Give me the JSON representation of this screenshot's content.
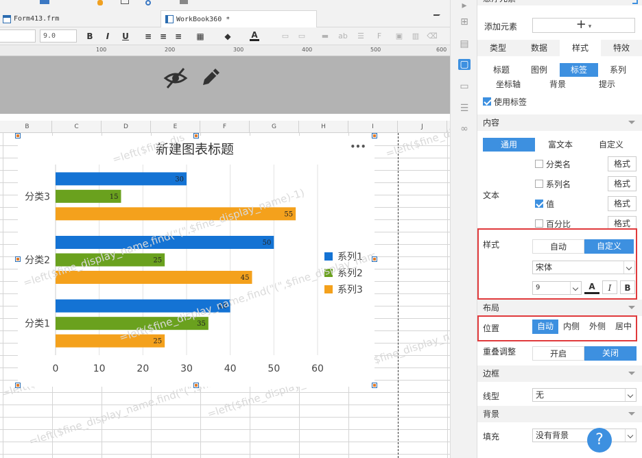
{
  "tabs": [
    {
      "label": "Form413.frm"
    },
    {
      "label": "WorkBook360 *"
    }
  ],
  "font_toolbar": {
    "font_size": "9.0",
    "bold": "B",
    "italic": "I",
    "underline": "U",
    "font_color": "A"
  },
  "ruler_ticks": [
    "100",
    "200",
    "300",
    "400",
    "500",
    "600",
    "700"
  ],
  "columns": [
    "B",
    "C",
    "D",
    "E",
    "F",
    "G",
    "H",
    "I",
    "J"
  ],
  "watermark": "=left($fine_display_name,find(\"(\",$fine_display_name)-1)",
  "watermark_short": "=left($fine_dis",
  "chart_menu": "•••",
  "chart_data": {
    "type": "bar",
    "orientation": "horizontal",
    "title": "新建图表标题",
    "categories": [
      "分类3",
      "分类2",
      "分类1"
    ],
    "series": [
      {
        "name": "系列1",
        "color": "#1473d4",
        "values": [
          30,
          50,
          40
        ]
      },
      {
        "name": "系列2",
        "color": "#6aa11e",
        "values": [
          15,
          25,
          35
        ]
      },
      {
        "name": "系列3",
        "color": "#f4a11c",
        "values": [
          55,
          45,
          25
        ]
      }
    ],
    "xlim": [
      0,
      60
    ],
    "xticks": [
      "0",
      "10",
      "20",
      "30",
      "40",
      "50",
      "60"
    ],
    "legend": "right",
    "grid": true
  },
  "panel": {
    "header": "悬浮元素",
    "add_label": "添加元素",
    "add_button": "+",
    "main_tabs": [
      {
        "label": "类型"
      },
      {
        "label": "数据"
      },
      {
        "label": "样式"
      },
      {
        "label": "特效"
      }
    ],
    "sub_tabs_1": [
      {
        "label": "标题"
      },
      {
        "label": "图例"
      },
      {
        "label": "标签"
      },
      {
        "label": "系列"
      }
    ],
    "sub_tabs_2": [
      {
        "label": "坐标轴"
      },
      {
        "label": "背景"
      },
      {
        "label": "提示"
      }
    ],
    "use_label": "使用标签",
    "content_section": "内容",
    "content_tabs": [
      {
        "label": "通用"
      },
      {
        "label": "富文本"
      },
      {
        "label": "自定义"
      }
    ],
    "text_label": "文本",
    "text_items": [
      {
        "label": "分类名",
        "checked": false,
        "button": "格式"
      },
      {
        "label": "系列名",
        "checked": false,
        "button": "格式"
      },
      {
        "label": "值",
        "checked": true,
        "button": "格式"
      },
      {
        "label": "百分比",
        "checked": false,
        "button": "格式"
      }
    ],
    "style_label": "样式",
    "style_options": [
      {
        "label": "自动"
      },
      {
        "label": "自定义"
      }
    ],
    "font_family": "宋体",
    "font_size": "9",
    "font_color_btn": "A",
    "italic_btn": "I",
    "bold_btn": "B",
    "layout_section": "布局",
    "position_label": "位置",
    "position_options": [
      {
        "label": "自动"
      },
      {
        "label": "内侧"
      },
      {
        "label": "外侧"
      },
      {
        "label": "居中"
      }
    ],
    "overlap_label": "重叠调整",
    "overlap_options": [
      {
        "label": "开启"
      },
      {
        "label": "关闭"
      }
    ],
    "border_section": "边框",
    "line_type_label": "线型",
    "line_type_value": "无",
    "background_section": "背景",
    "fill_label": "填充",
    "fill_value": "没有背景",
    "help_button": "?"
  },
  "colors": {
    "accent": "#3d90e0",
    "highlight": "#e0393b"
  }
}
